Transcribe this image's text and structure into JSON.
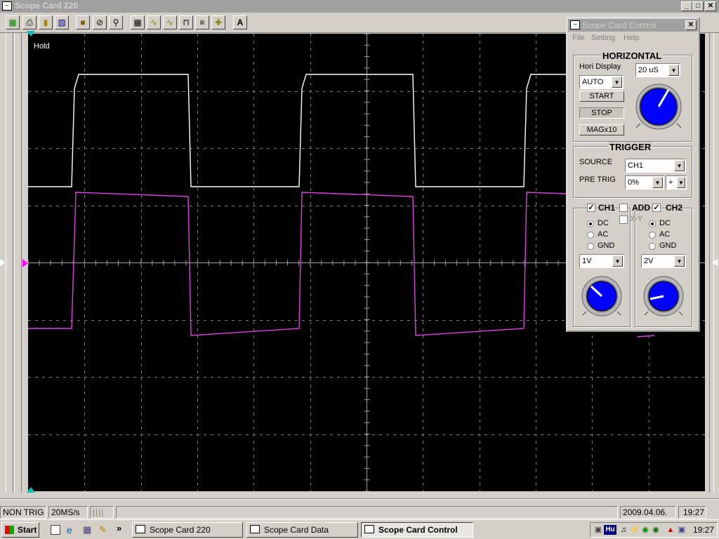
{
  "main_window": {
    "title": "Scope Card 220",
    "controls": {
      "minimize": "_",
      "maximize": "□",
      "close": "✕"
    }
  },
  "toolbar": {
    "icons": [
      "open-icon",
      "print-icon",
      "folder-icon",
      "save-icon",
      "scope-icon",
      "stop-icon",
      "zoom-icon",
      "grid-icon",
      "sine-icon",
      "sine-alt-icon",
      "pulse-icon",
      "dashes-icon",
      "cursor-icon",
      "measure-text-icon"
    ]
  },
  "scope": {
    "status_label": "Hold",
    "traces": {
      "ch1_color": "#ffffff",
      "ch2_color": "#e040e0",
      "trigger_marker_color": "#00c0c0",
      "level_marker_color": "#ff00ff"
    }
  },
  "status_bar": {
    "trigger": "NON TRIG",
    "sample_rate": "20MS/s",
    "date": "2009.04.06.",
    "time": "19:27"
  },
  "control_panel": {
    "title": "Scope Card Control",
    "close": "✕",
    "menu": [
      "File",
      "Setting",
      "Help"
    ],
    "horizontal": {
      "title": "HORIZONTAL",
      "hori_display_label": "Hori Display",
      "timebase": "20 uS",
      "mode": "AUTO",
      "start_label": "START",
      "stop_label": "STOP",
      "mag_label": "MAGx10"
    },
    "trigger": {
      "title": "TRIGGER",
      "source_label": "SOURCE",
      "source_value": "CH1",
      "pretrig_label": "PRE TRIG",
      "pretrig_value": "0%",
      "slope_value": "+"
    },
    "channels": {
      "ch1_label": "CH1",
      "ch1_checked": true,
      "add_label": "ADD",
      "add_checked": false,
      "xy_label": "X-Y",
      "xy_checked": false,
      "ch2_label": "CH2",
      "ch2_checked": true,
      "coupling_options": [
        "DC",
        "AC",
        "GND"
      ],
      "ch1_coupling": "DC",
      "ch2_coupling": "DC",
      "ch1_volts": "1V",
      "ch2_volts": "2V"
    }
  },
  "taskbar": {
    "start_label": "Start",
    "chevron": "»",
    "tasks": [
      {
        "label": "Scope Card 220",
        "active": false
      },
      {
        "label": "Scope Card Data",
        "active": false
      },
      {
        "label": "Scope Card Control",
        "active": true
      }
    ],
    "tray_text": "Hu",
    "clock": "19:27"
  }
}
